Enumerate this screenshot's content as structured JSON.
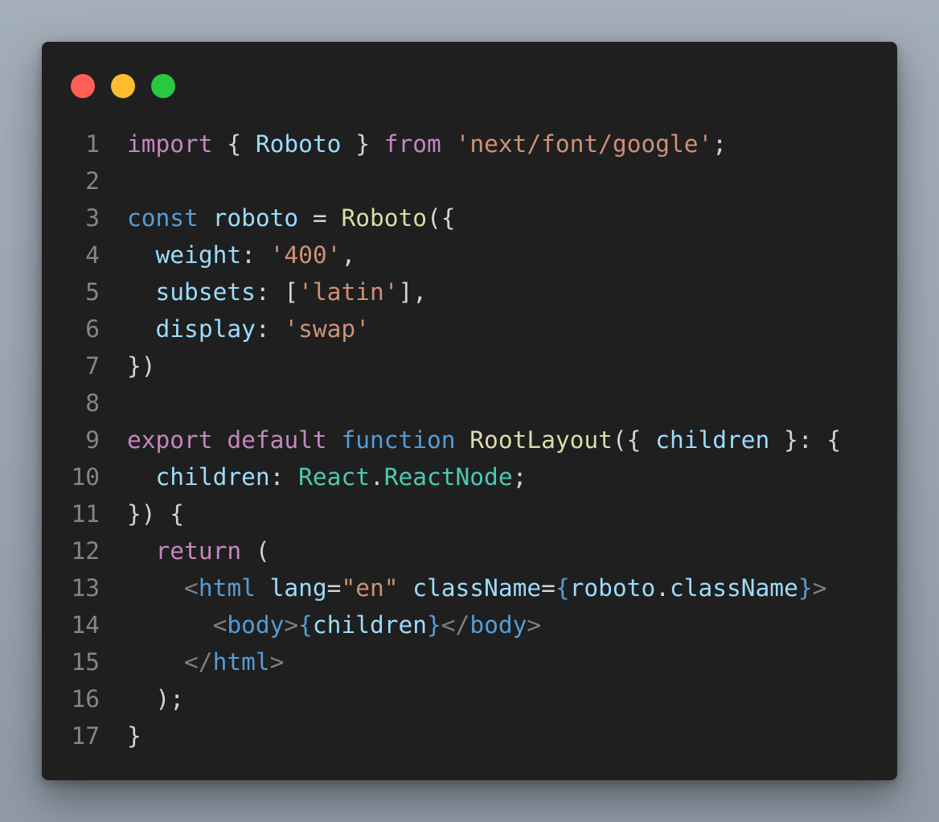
{
  "window": {
    "traffic_lights": [
      {
        "name": "close",
        "color": "#ff5f57"
      },
      {
        "name": "minimize",
        "color": "#febc2e"
      },
      {
        "name": "maximize",
        "color": "#28c840"
      }
    ]
  },
  "colors": {
    "background": "#1f1f1f",
    "line_number": "#858585",
    "keyword_control": "#c586c0",
    "keyword": "#569cd6",
    "variable": "#9cdcfe",
    "string": "#ce9178",
    "function": "#dcdcaa",
    "type": "#4ec9b0",
    "punctuation": "#d4d4d4",
    "jsx_bracket": "#808080"
  },
  "code_lines": [
    {
      "n": "1",
      "tokens": [
        [
          "import",
          "kc"
        ],
        [
          " { ",
          "p"
        ],
        [
          "Roboto",
          "v"
        ],
        [
          " } ",
          "p"
        ],
        [
          "from",
          "kc"
        ],
        [
          " ",
          "p"
        ],
        [
          "'next/font/google'",
          "s"
        ],
        [
          ";",
          "p"
        ]
      ]
    },
    {
      "n": "2",
      "tokens": []
    },
    {
      "n": "3",
      "tokens": [
        [
          "const",
          "k"
        ],
        [
          " ",
          "p"
        ],
        [
          "roboto",
          "v"
        ],
        [
          " = ",
          "p"
        ],
        [
          "Roboto",
          "f"
        ],
        [
          "({",
          "p"
        ]
      ]
    },
    {
      "n": "4",
      "tokens": [
        [
          "  ",
          "p"
        ],
        [
          "weight",
          "v"
        ],
        [
          ": ",
          "p"
        ],
        [
          "'400'",
          "s"
        ],
        [
          ",",
          "p"
        ]
      ]
    },
    {
      "n": "5",
      "tokens": [
        [
          "  ",
          "p"
        ],
        [
          "subsets",
          "v"
        ],
        [
          ": [",
          "p"
        ],
        [
          "'latin'",
          "s"
        ],
        [
          "],",
          "p"
        ]
      ]
    },
    {
      "n": "6",
      "tokens": [
        [
          "  ",
          "p"
        ],
        [
          "display",
          "v"
        ],
        [
          ": ",
          "p"
        ],
        [
          "'swap'",
          "s"
        ]
      ]
    },
    {
      "n": "7",
      "tokens": [
        [
          "})",
          "p"
        ]
      ]
    },
    {
      "n": "8",
      "tokens": []
    },
    {
      "n": "9",
      "tokens": [
        [
          "export",
          "kc"
        ],
        [
          " ",
          "p"
        ],
        [
          "default",
          "kc"
        ],
        [
          " ",
          "p"
        ],
        [
          "function",
          "k"
        ],
        [
          " ",
          "p"
        ],
        [
          "RootLayout",
          "f"
        ],
        [
          "({ ",
          "p"
        ],
        [
          "children",
          "v"
        ],
        [
          " }: {",
          "p"
        ]
      ]
    },
    {
      "n": "10",
      "tokens": [
        [
          "  ",
          "p"
        ],
        [
          "children",
          "v"
        ],
        [
          ": ",
          "p"
        ],
        [
          "React",
          "t"
        ],
        [
          ".",
          "p"
        ],
        [
          "ReactNode",
          "t"
        ],
        [
          ";",
          "p"
        ]
      ]
    },
    {
      "n": "11",
      "tokens": [
        [
          "}) {",
          "p"
        ]
      ]
    },
    {
      "n": "12",
      "tokens": [
        [
          "  ",
          "p"
        ],
        [
          "return",
          "kc"
        ],
        [
          " (",
          "p"
        ]
      ]
    },
    {
      "n": "13",
      "tokens": [
        [
          "    ",
          "p"
        ],
        [
          "<",
          "j"
        ],
        [
          "html",
          "k"
        ],
        [
          " ",
          "p"
        ],
        [
          "lang",
          "v"
        ],
        [
          "=",
          "p"
        ],
        [
          "\"en\"",
          "s"
        ],
        [
          " ",
          "p"
        ],
        [
          "className",
          "v"
        ],
        [
          "=",
          "p"
        ],
        [
          "{",
          "k"
        ],
        [
          "roboto",
          "v"
        ],
        [
          ".",
          "p"
        ],
        [
          "className",
          "v"
        ],
        [
          "}",
          "k"
        ],
        [
          ">",
          "j"
        ]
      ]
    },
    {
      "n": "14",
      "tokens": [
        [
          "      ",
          "p"
        ],
        [
          "<",
          "j"
        ],
        [
          "body",
          "k"
        ],
        [
          ">",
          "j"
        ],
        [
          "{",
          "k"
        ],
        [
          "children",
          "v"
        ],
        [
          "}",
          "k"
        ],
        [
          "</",
          "j"
        ],
        [
          "body",
          "k"
        ],
        [
          ">",
          "j"
        ]
      ]
    },
    {
      "n": "15",
      "tokens": [
        [
          "    ",
          "p"
        ],
        [
          "</",
          "j"
        ],
        [
          "html",
          "k"
        ],
        [
          ">",
          "j"
        ]
      ]
    },
    {
      "n": "16",
      "tokens": [
        [
          "  );",
          "p"
        ]
      ]
    },
    {
      "n": "17",
      "tokens": [
        [
          "}",
          "p"
        ]
      ]
    }
  ]
}
